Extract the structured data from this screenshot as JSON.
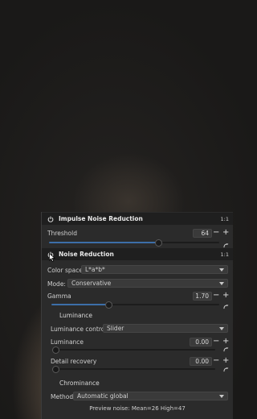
{
  "impulse": {
    "title": "Impulse Noise Reduction",
    "one_to_one": "1:1",
    "threshold": {
      "label": "Threshold",
      "value": "64",
      "fraction": 0.64
    }
  },
  "noise": {
    "title": "Noise Reduction",
    "one_to_one": "1:1",
    "color_space": {
      "label": "Color space:",
      "value": "L*a*b*"
    },
    "mode": {
      "label": "Mode:",
      "value": "Conservative"
    },
    "gamma": {
      "label": "Gamma",
      "value": "1.70",
      "fraction": 0.34
    },
    "luminance_section": "Luminance",
    "luminance_control": {
      "label": "Luminance control:",
      "value": "Slider"
    },
    "luminance": {
      "label": "Luminance",
      "value": "0.00",
      "fraction": 0.0
    },
    "detail_recovery": {
      "label": "Detail recovery",
      "value": "0.00",
      "fraction": 0.0
    },
    "chrominance_section": "Chrominance",
    "method": {
      "label": "Method:",
      "value": "Automatic global"
    },
    "preview": "Preview noise: Mean=26  High=47"
  },
  "buttons": {
    "minus": "−",
    "plus": "+"
  },
  "colors": {
    "panel_bg": "#2b2b2b",
    "header_bg": "#1f1f1f",
    "slider_fill": "#3c6ea8"
  },
  "icons": [
    "power-icon",
    "reset-icon",
    "chevron-down-icon",
    "mouse-cursor-icon"
  ]
}
